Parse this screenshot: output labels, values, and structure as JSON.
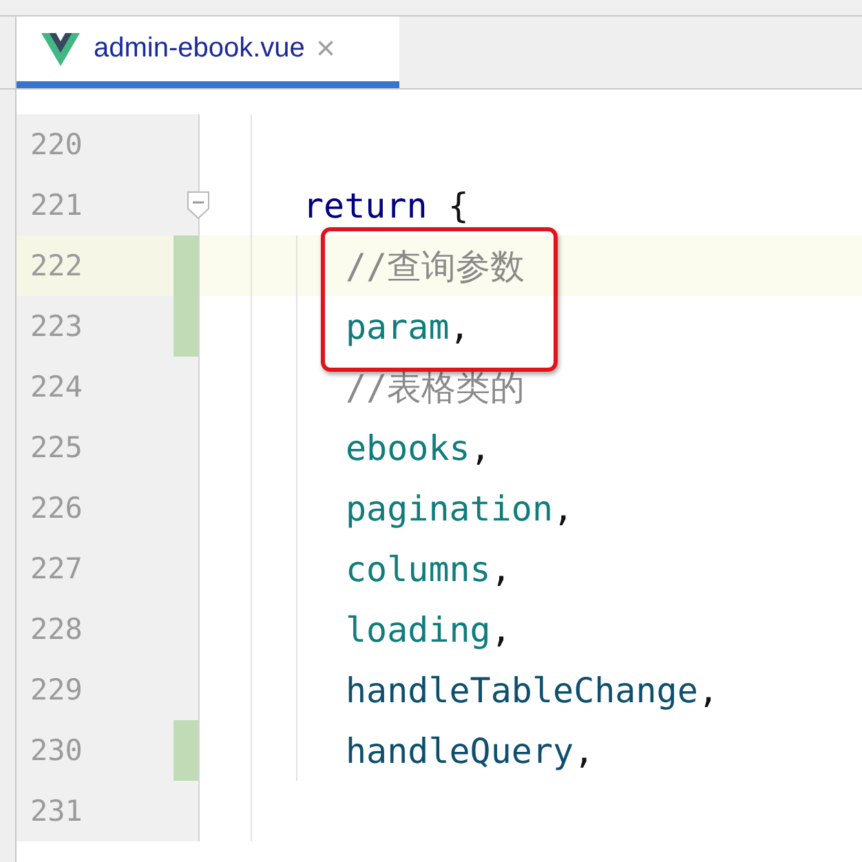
{
  "tabs": [
    {
      "label": "admin-ebook.vue",
      "selected": true,
      "close": "×"
    }
  ],
  "lines": [
    {
      "number": "220",
      "changed": false,
      "highlighted": false,
      "foldable": false,
      "boxed": false
    },
    {
      "number": "221",
      "tokens": [
        {
          "kind": "keyword",
          "text": "return"
        },
        {
          "kind": "punct",
          "text": " {"
        }
      ],
      "changed": false,
      "highlighted": false,
      "foldable": true,
      "boxed": false,
      "children": [
        {
          "number": "222",
          "tokens": [
            {
              "kind": "comment",
              "text": "//查询参数"
            }
          ],
          "changed": true,
          "highlighted": true,
          "foldable": false,
          "boxed": true
        },
        {
          "number": "223",
          "tokens": [
            {
              "kind": "property",
              "text": "param"
            },
            {
              "kind": "punct",
              "text": ","
            }
          ],
          "changed": true,
          "highlighted": false,
          "foldable": false,
          "boxed": true
        },
        {
          "number": "224",
          "tokens": [
            {
              "kind": "comment",
              "text": "//表格类的"
            }
          ],
          "changed": false,
          "highlighted": false,
          "foldable": false,
          "boxed": false
        },
        {
          "number": "225",
          "tokens": [
            {
              "kind": "property",
              "text": "ebooks"
            },
            {
              "kind": "punct",
              "text": ","
            }
          ],
          "changed": false,
          "highlighted": false,
          "foldable": false,
          "boxed": false
        },
        {
          "number": "226",
          "tokens": [
            {
              "kind": "property",
              "text": "pagination"
            },
            {
              "kind": "punct",
              "text": ","
            }
          ],
          "changed": false,
          "highlighted": false,
          "foldable": false,
          "boxed": false
        },
        {
          "number": "227",
          "tokens": [
            {
              "kind": "property",
              "text": "columns"
            },
            {
              "kind": "punct",
              "text": ","
            }
          ],
          "changed": false,
          "highlighted": false,
          "foldable": false,
          "boxed": false
        },
        {
          "number": "228",
          "tokens": [
            {
              "kind": "property",
              "text": "loading"
            },
            {
              "kind": "punct",
              "text": ","
            }
          ],
          "changed": false,
          "highlighted": false,
          "foldable": false,
          "boxed": false
        },
        {
          "number": "229",
          "tokens": [
            {
              "kind": "method",
              "text": "handleTableChange"
            },
            {
              "kind": "punct",
              "text": ","
            }
          ],
          "changed": false,
          "highlighted": false,
          "foldable": false,
          "boxed": false
        },
        {
          "number": "230",
          "tokens": [
            {
              "kind": "method",
              "text": "handleQuery"
            },
            {
              "kind": "punct",
              "text": ","
            }
          ],
          "changed": true,
          "highlighted": false,
          "foldable": false,
          "boxed": false
        }
      ]
    },
    {
      "number": "231",
      "changed": false,
      "highlighted": false,
      "foldable": false,
      "boxed": false
    }
  ]
}
